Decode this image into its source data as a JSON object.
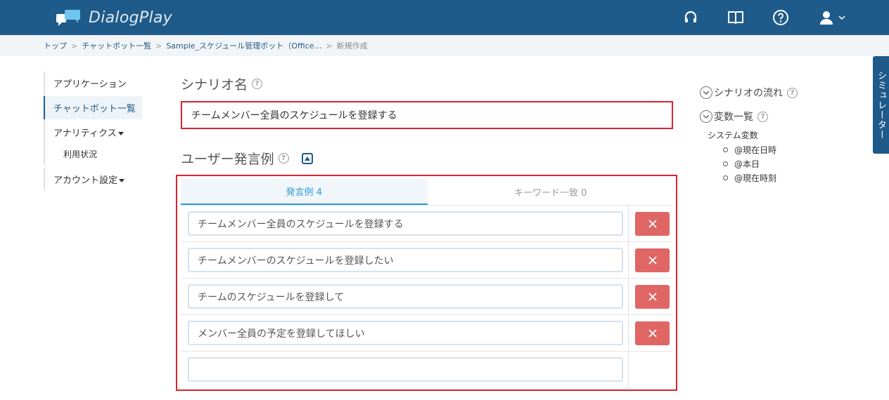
{
  "app": {
    "name": "DialogPlay",
    "header_icons": [
      "headset-icon",
      "book-icon",
      "help-icon",
      "user-icon",
      "chevron-down-icon"
    ]
  },
  "breadcrumb": {
    "items": [
      "トップ",
      "チャットボット一覧",
      "Sample_スケジュール管理ボット（Office…"
    ],
    "separator": ">",
    "current": "新規作成"
  },
  "leftnav": {
    "items": [
      {
        "label": "アプリケーション"
      },
      {
        "label": "チャットボット一覧"
      },
      {
        "label": "アナリティクス"
      },
      {
        "label": "利用状況"
      },
      {
        "label": "アカウント設定"
      }
    ]
  },
  "scenario": {
    "title": "シナリオ名",
    "help": "?",
    "name_value": "チームメンバー全員のスケジュールを登録する"
  },
  "examples": {
    "title": "ユーザー発言例",
    "help": "?",
    "tabs": [
      {
        "label": "発言例 4"
      },
      {
        "label": "キーワード一致 0"
      }
    ],
    "rows": [
      {
        "value": "チームメンバー全員のスケジュールを登録する"
      },
      {
        "value": "チームメンバーのスケジュールを登録したい"
      },
      {
        "value": "チームのスケジュールを登録して"
      },
      {
        "value": "メンバー全員の予定を登録してほしい"
      },
      {
        "value": ""
      }
    ]
  },
  "right_panel": {
    "flow_label": "シナリオの流れ",
    "vars_label": "変数一覧",
    "help": "?",
    "system_vars_label": "システム変数",
    "system_vars": [
      "@現在日時",
      "@本日",
      "@現在時刻"
    ]
  },
  "simulator": {
    "label": "シミュレーター"
  },
  "colors": {
    "header": "#1f5b8a",
    "highlight_border": "#d9232d",
    "delete_button": "#e06666",
    "active_tab": "#2a9bd4"
  }
}
